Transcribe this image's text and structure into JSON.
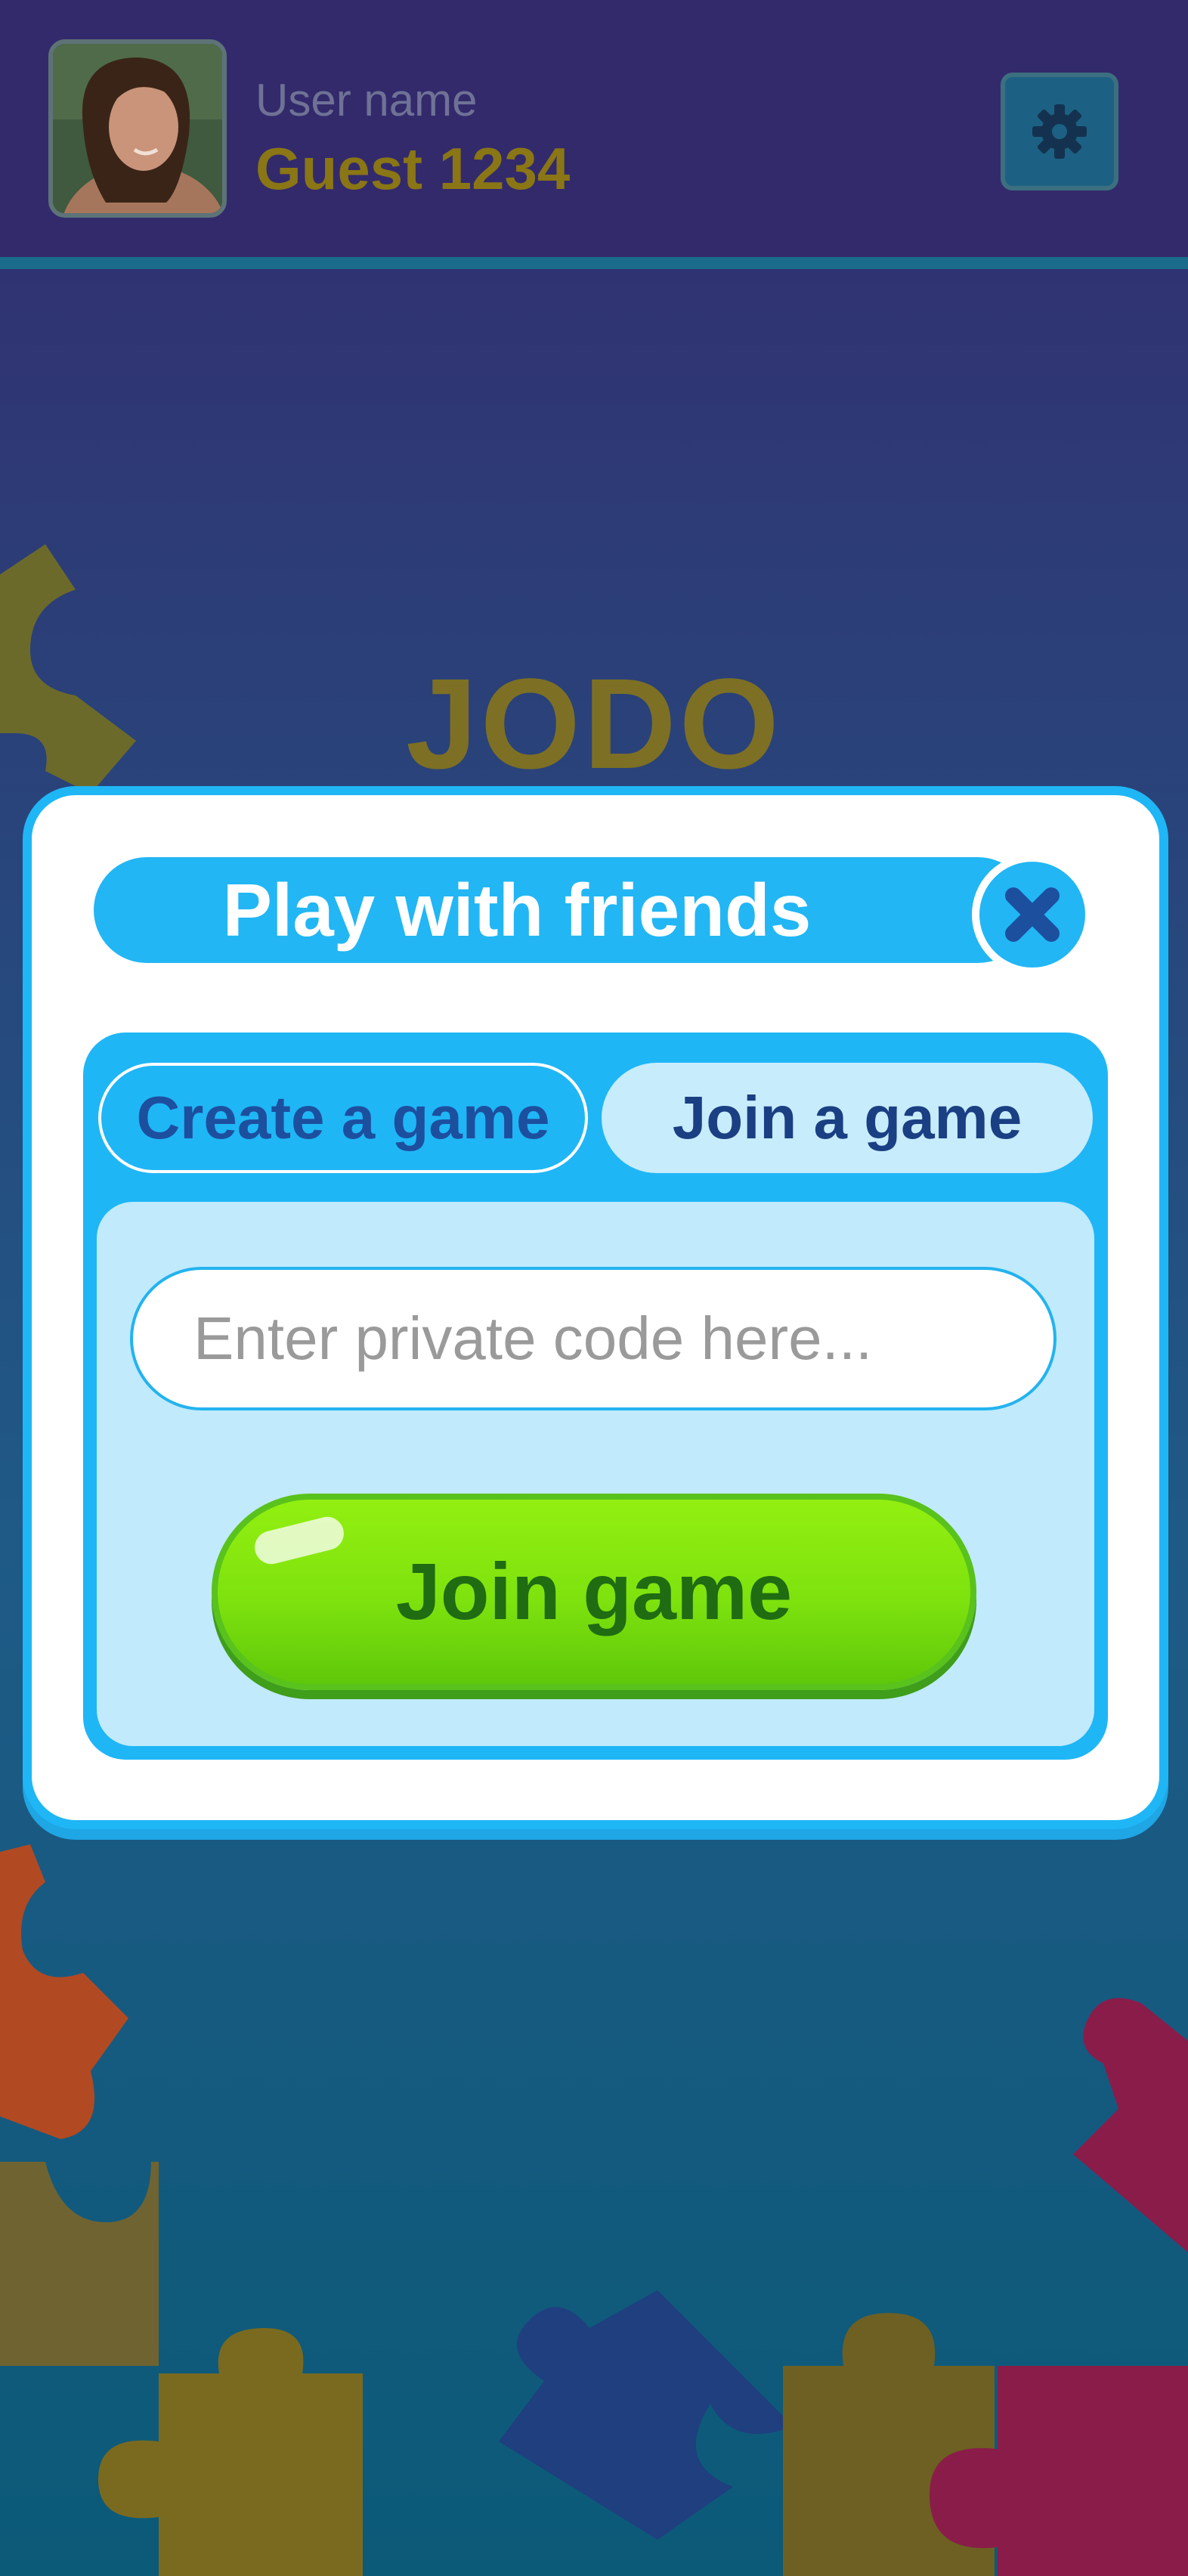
{
  "header": {
    "username_label": "User name",
    "username_value": "Guest 1234",
    "settings_icon": "gear-icon"
  },
  "logo": {
    "text": "JODO"
  },
  "modal": {
    "title": "Play with friends",
    "close_icon": "close-icon",
    "tabs": [
      {
        "label": "Create a game",
        "selected": false
      },
      {
        "label": "Join a game",
        "selected": true
      }
    ],
    "code_input": {
      "placeholder": "Enter private code here...",
      "value": ""
    },
    "join_button": "Join game"
  },
  "colors": {
    "accent_blue": "#1fb6f6",
    "button_green": "#7ee20e",
    "header_bg": "#332a6c",
    "username_gold": "#8a7615"
  }
}
